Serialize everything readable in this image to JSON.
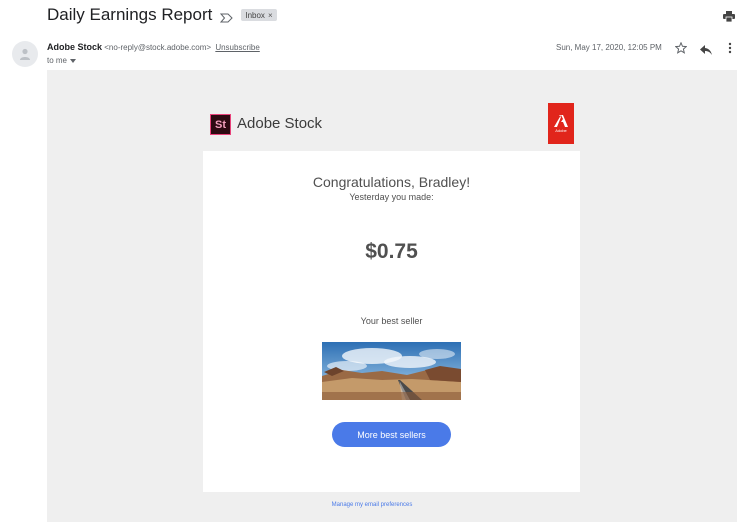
{
  "subject": "Daily Earnings Report",
  "label": {
    "text": "Inbox",
    "remove": "×"
  },
  "sender": {
    "name": "Adobe Stock",
    "email": "<no-reply@stock.adobe.com>",
    "unsubscribe": "Unsubscribe",
    "to": "to me",
    "date": "Sun, May 17, 2020, 12:05 PM"
  },
  "brand": {
    "logo_text": "St",
    "name": "Adobe Stock",
    "badge_text": "Adobe"
  },
  "body": {
    "congrats": "Congratulations, Bradley!",
    "yesterday": "Yesterday you made:",
    "amount": "$0.75",
    "best_seller_label": "Your best seller",
    "button": "More best sellers"
  },
  "footer": {
    "manage": "Manage my email preferences"
  },
  "colors": {
    "accent": "#4a7ae8",
    "adobe_red": "#e1251b",
    "email_bg": "#efefef"
  },
  "icons": [
    "important-icon",
    "print-icon",
    "avatar-icon",
    "chevron-down-icon",
    "star-icon",
    "reply-icon",
    "more-vert-icon",
    "adobe-logo-icon"
  ]
}
